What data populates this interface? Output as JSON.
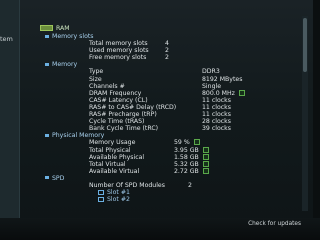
{
  "side": {
    "label": "tem"
  },
  "header": {
    "title": "RAM"
  },
  "sections": [
    {
      "title": "Memory slots",
      "rows": [
        {
          "label": "Total memory slots",
          "value": "4"
        },
        {
          "label": "Used memory slots",
          "value": "2"
        },
        {
          "label": "Free memory slots",
          "value": "2"
        }
      ]
    },
    {
      "title": "Memory",
      "rows": [
        {
          "label": "Type",
          "value": "DDR3"
        },
        {
          "label": "Size",
          "value": "8192 MBytes"
        },
        {
          "label": "Channels #",
          "value": "Single"
        },
        {
          "label": "DRAM Frequency",
          "value": "800.0 MHz"
        },
        {
          "label": "CAS# Latency (CL)",
          "value": "11 clocks"
        },
        {
          "label": "RAS# to CAS# Delay (tRCD)",
          "value": "11 clocks"
        },
        {
          "label": "RAS# Precharge (tRP)",
          "value": "11 clocks"
        },
        {
          "label": "Cycle Time (tRAS)",
          "value": "28 clocks"
        },
        {
          "label": "Bank Cycle Time (tRC)",
          "value": "39 clocks"
        }
      ]
    },
    {
      "title": "Physical Memory",
      "rows": [
        {
          "label": "Memory Usage",
          "value": "59 %"
        },
        {
          "label": "Total Physical",
          "value": "3.95 GB"
        },
        {
          "label": "Available Physical",
          "value": "1.58 GB"
        },
        {
          "label": "Total Virtual",
          "value": "5.32 GB"
        },
        {
          "label": "Available Virtual",
          "value": "2.72 GB"
        }
      ]
    },
    {
      "title": "SPD",
      "rows": [
        {
          "label": "Number Of SPD Modules",
          "value": "2"
        }
      ],
      "slots": [
        "Slot #1",
        "Slot #2"
      ]
    }
  ],
  "footer": {
    "link": "Check for updates"
  }
}
